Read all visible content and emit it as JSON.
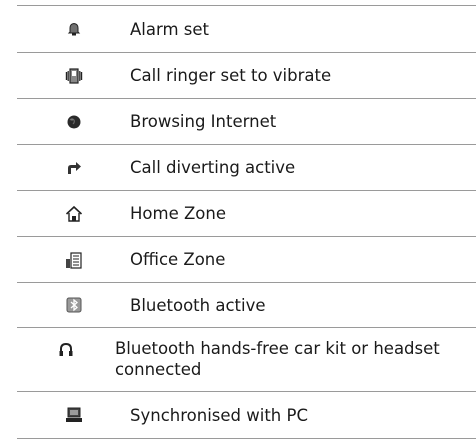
{
  "rows": [
    {
      "icon": "alarm-icon",
      "label": "Alarm set"
    },
    {
      "icon": "vibrate-icon",
      "label": "Call ringer set to vibrate"
    },
    {
      "icon": "internet-globe-icon",
      "label": "Browsing Internet"
    },
    {
      "icon": "call-divert-icon",
      "label": "Call diverting active"
    },
    {
      "icon": "home-zone-icon",
      "label": "Home Zone"
    },
    {
      "icon": "office-zone-icon",
      "label": "Office Zone"
    },
    {
      "icon": "bluetooth-icon",
      "label": "Bluetooth active"
    },
    {
      "icon": "headset-icon",
      "label": "Bluetooth hands-free car kit or headset connected"
    },
    {
      "icon": "pc-sync-icon",
      "label": "Synchronised with PC"
    }
  ]
}
